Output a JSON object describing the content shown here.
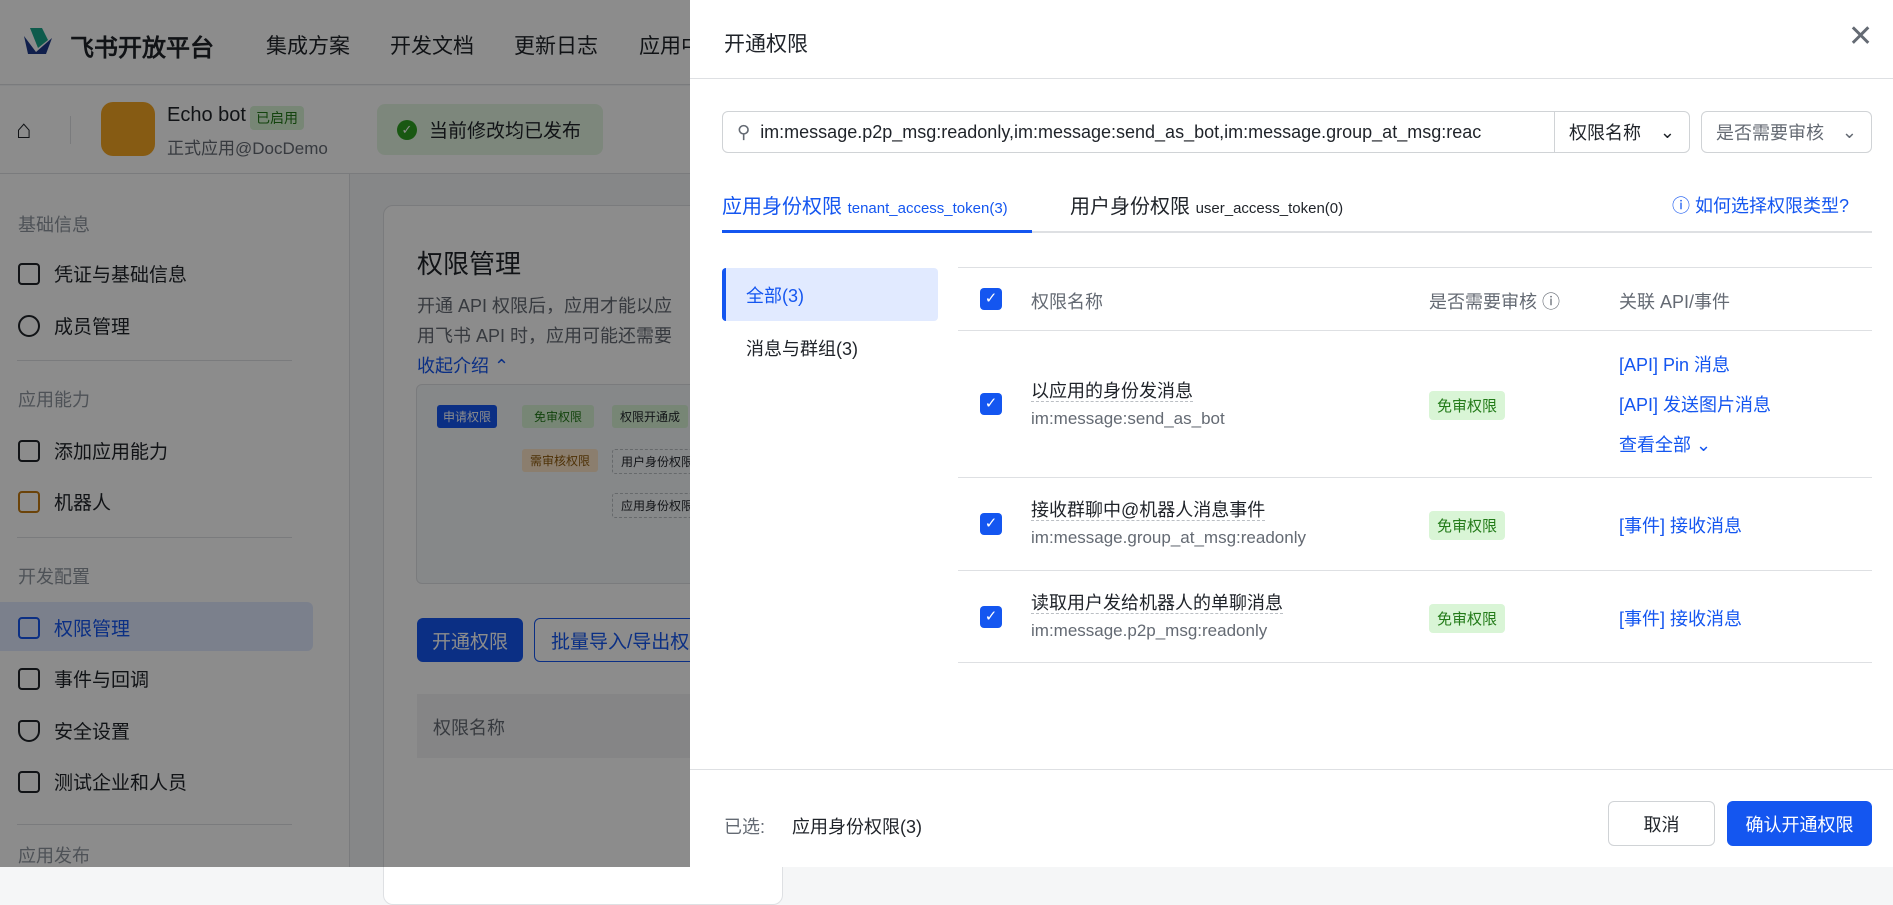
{
  "topbar": {
    "brand": "飞书开放平台",
    "nav": [
      "集成方案",
      "开发文档",
      "更新日志",
      "应用中"
    ]
  },
  "app": {
    "name": "Echo bot",
    "status": "已启用",
    "subtitle": "正式应用@DocDemo",
    "banner": "当前修改均已发布"
  },
  "sidebar": {
    "sections": [
      {
        "title": "基础信息",
        "items": [
          {
            "label": "凭证与基础信息",
            "icon": "credential-icon"
          },
          {
            "label": "成员管理",
            "icon": "member-add-icon"
          }
        ]
      },
      {
        "title": "应用能力",
        "items": [
          {
            "label": "添加应用能力",
            "icon": "grid-add-icon"
          },
          {
            "label": "机器人",
            "icon": "robot-icon"
          }
        ]
      },
      {
        "title": "开发配置",
        "items": [
          {
            "label": "权限管理",
            "icon": "lock-bag-icon",
            "active": true
          },
          {
            "label": "事件与回调",
            "icon": "event-icon"
          },
          {
            "label": "安全设置",
            "icon": "shield-icon"
          },
          {
            "label": "测试企业和人员",
            "icon": "code-icon"
          }
        ]
      },
      {
        "title": "应用发布",
        "items": []
      }
    ]
  },
  "page": {
    "title": "权限管理",
    "desc1": "开通 API 权限后，应用才能以应",
    "desc2": "用飞书 API 时，应用可能还需要",
    "collapse": "收起介绍",
    "flow": {
      "apply": "申请权限",
      "free": "免审权限",
      "success": "权限开通成",
      "review": "需审核权限",
      "user": "用户身份权限",
      "tenant": "应用身份权限"
    },
    "btn_open": "开通权限",
    "btn_batch": "批量导入/导出权",
    "col_name": "权限名称"
  },
  "modal": {
    "title": "开通权限",
    "search_value": "im:message.p2p_msg:readonly,im:message:send_as_bot,im:message.group_at_msg:reac",
    "filter1": "权限名称",
    "filter2": "是否需要审核",
    "tabs": [
      {
        "label": "应用身份权限",
        "sub": "tenant_access_token(3)",
        "active": true
      },
      {
        "label": "用户身份权限",
        "sub": "user_access_token(0)"
      }
    ],
    "help": "如何选择权限类型?",
    "categories": [
      {
        "label": "全部(3)",
        "active": true
      },
      {
        "label": "消息与群组(3)"
      }
    ],
    "columns": [
      "权限名称",
      "是否需要审核",
      "关联 API/事件"
    ],
    "rows": [
      {
        "name": "以应用的身份发消息",
        "code": "im:message:send_as_bot",
        "review": "免审权限",
        "links": [
          "[API] Pin 消息",
          "[API] 发送图片消息"
        ],
        "more": "查看全部",
        "checked": true
      },
      {
        "name": "接收群聊中@机器人消息事件",
        "code": "im:message.group_at_msg:readonly",
        "review": "免审权限",
        "links": [
          "[事件] 接收消息"
        ],
        "checked": true
      },
      {
        "name": "读取用户发给机器人的单聊消息",
        "code": "im:message.p2p_msg:readonly",
        "review": "免审权限",
        "links": [
          "[事件] 接收消息"
        ],
        "checked": true
      }
    ],
    "footer": {
      "selected_label": "已选:",
      "selected_value": "应用身份权限(3)",
      "cancel": "取消",
      "confirm": "确认开通权限"
    }
  },
  "colors": {
    "primary": "#1456f0",
    "tag_bg": "#d9f5d6",
    "tag_text": "#237b19"
  }
}
